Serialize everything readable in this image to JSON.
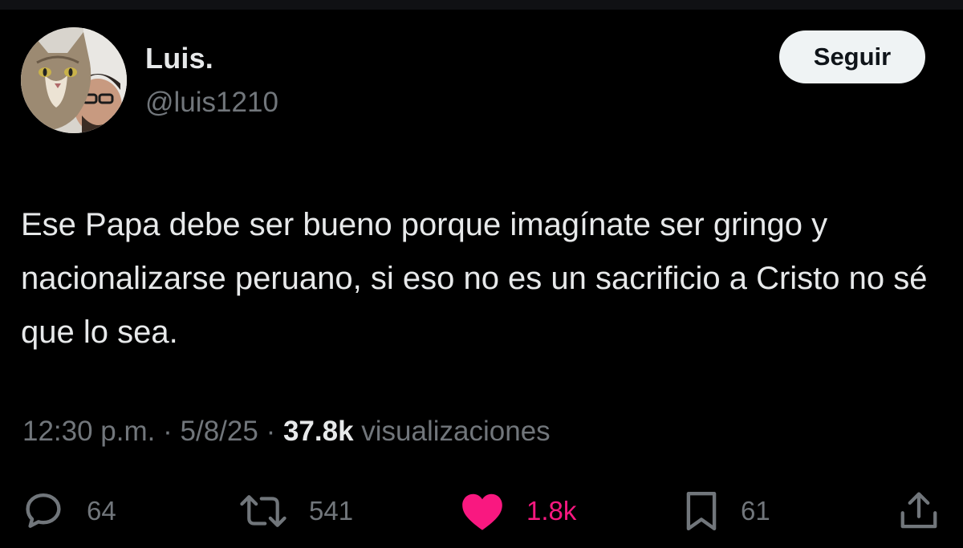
{
  "user": {
    "display_name": "Luis.",
    "handle": "@luis1210",
    "avatar_icon": "cat-and-man-profile-photo"
  },
  "follow_button": {
    "label": "Seguir"
  },
  "tweet": {
    "text": "Ese Papa debe ser bueno porque imagínate ser gringo y nacionalizarse peruano, si eso no es un sacrificio a Cristo no sé que lo sea."
  },
  "meta": {
    "time": "12:30 p.m.",
    "separator": "·",
    "date": "5/8/25",
    "views_count": "37.8k",
    "views_label": "visualizaciones"
  },
  "actions": {
    "reply": {
      "icon": "reply-icon",
      "count": "64"
    },
    "repost": {
      "icon": "repost-icon",
      "count": "541"
    },
    "like": {
      "icon": "heart-icon",
      "count": "1.8k",
      "liked": true,
      "color": "#f91880"
    },
    "bookmark": {
      "icon": "bookmark-icon",
      "count": "61"
    },
    "share": {
      "icon": "share-icon"
    }
  },
  "colors": {
    "background": "#000000",
    "primary_text": "#e7e9ea",
    "secondary_text": "#71767b",
    "like_pink": "#f91880",
    "follow_button_bg": "#eff3f4"
  }
}
